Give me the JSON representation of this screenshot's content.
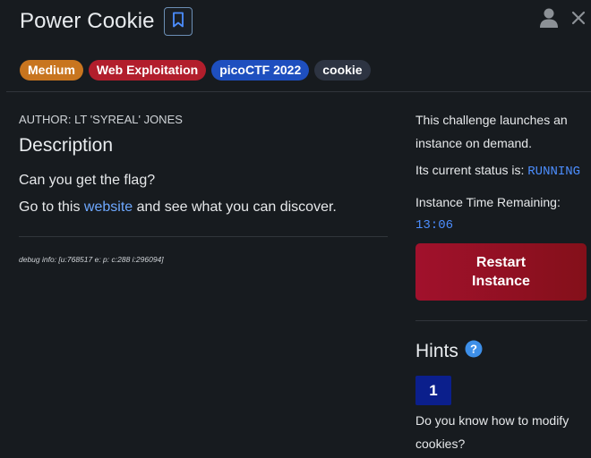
{
  "challenge": {
    "title": "Power Cookie",
    "tags": [
      "Medium",
      "Web Exploitation",
      "picoCTF 2022",
      "cookie"
    ],
    "author": "AUTHOR: LT 'SYREAL' JONES",
    "description_heading": "Description",
    "description_line1": "Can you get the flag?",
    "description_line2_before": "Go to this ",
    "description_link": "website",
    "description_line2_after": " and see what you can discover.",
    "debug_info": "debug info: [u:768517 e: p: c:288 i:296094]"
  },
  "instance": {
    "launch_text": "This challenge launches an instance on demand.",
    "status_label": "Its current status is: ",
    "status_value": "RUNNING",
    "time_label": "Instance Time Remaining:",
    "time_value": "13:06",
    "restart_label": "Restart Instance"
  },
  "hints": {
    "heading": "Hints",
    "hint_number": "1",
    "hint_text": "Do you know how to modify cookies?"
  },
  "icons": [
    "bookmark-icon",
    "user-icon",
    "close-icon",
    "help-icon"
  ],
  "colors": {
    "background": "#171b1f",
    "medium_tag": "#c8751f",
    "web_tag": "#b21e2c",
    "pico_tag": "#1e4fbf",
    "cookie_tag": "#2d3442",
    "link": "#6ea8ff",
    "mono_accent": "#4c8eff",
    "restart_button": "#a1112c",
    "hint_button": "#0b1f8c"
  }
}
